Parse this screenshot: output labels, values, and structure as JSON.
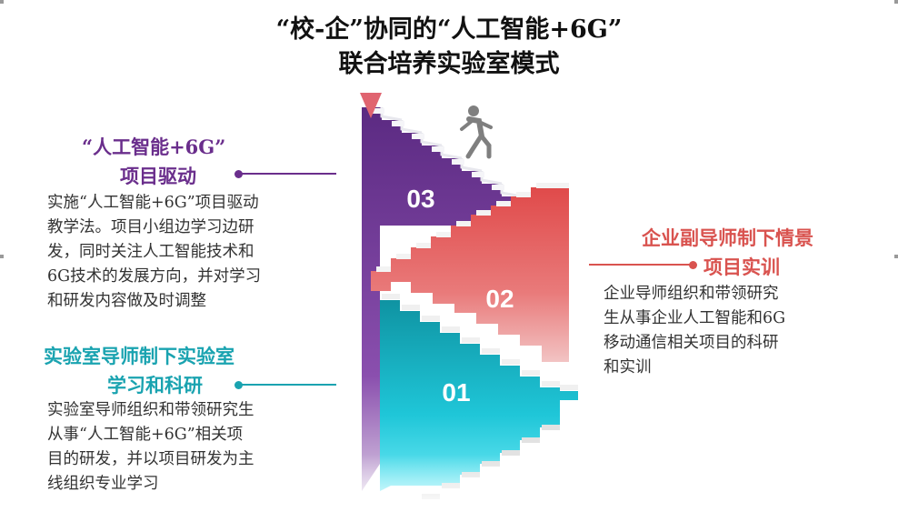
{
  "title": {
    "line1": "“校-企”协同的“人工智能+6G”",
    "line2": "联合培养实验室模式"
  },
  "blocks": [
    {
      "number": "03",
      "heading_line1": "“人工智能+6G”",
      "heading_line2": "项目驱动",
      "text": [
        "实施“人工智能+6G”项目驱动",
        "教学法。项目小组边学习边研",
        "发，同时关注人工智能技术和",
        "6G技术的发展方向，并对学习",
        "和研发内容做及时调整"
      ],
      "color": "#6a2e8c"
    },
    {
      "number": "02",
      "heading_line1": "企业副导师制下情景",
      "heading_line2": "项目实训",
      "text": [
        "企业导师组织和带领研究",
        "生从事企业人工智能和6G",
        "移动通信相关项目的科研",
        "和实训"
      ],
      "color": "#d9534f"
    },
    {
      "number": "01",
      "heading_line1": "实验室导师制下实验室",
      "heading_line2": "学习和科研",
      "text": [
        "实验室导师组织和带领研究生",
        "从事“人工智能+6G”相关项",
        "目的研发，并以项目研发为主",
        "线组织专业学习"
      ],
      "color": "#1aa3b0"
    }
  ],
  "icons": [
    "runner-icon",
    "down-arrow-icon"
  ]
}
